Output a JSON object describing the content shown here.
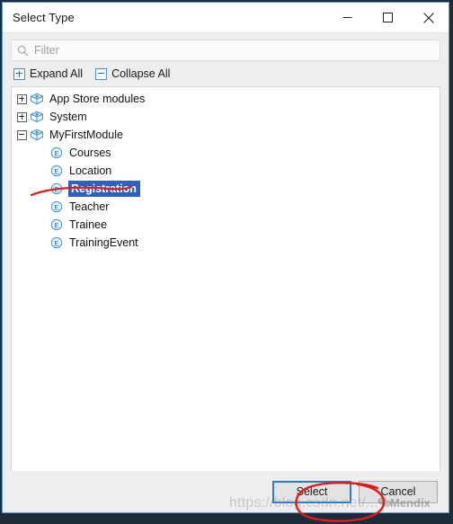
{
  "window": {
    "title": "Select Type",
    "controls": [
      {
        "name": "minimize",
        "glyph": "minimize-icon"
      },
      {
        "name": "maximize",
        "glyph": "maximize-icon"
      },
      {
        "name": "close",
        "glyph": "close-icon"
      }
    ]
  },
  "search": {
    "placeholder": "Filter",
    "value": "",
    "icon": "search-icon"
  },
  "toolbar": {
    "expand_all": "Expand All",
    "collapse_all": "Collapse All",
    "expand_icon": "plus-box-icon",
    "collapse_icon": "minus-box-icon"
  },
  "tree": {
    "nodes": [
      {
        "label": "App Store modules",
        "icon": "module-package-icon",
        "twisty": "plus",
        "depth": 0,
        "selected": false
      },
      {
        "label": "System",
        "icon": "module-package-icon",
        "twisty": "plus",
        "depth": 0,
        "selected": false
      },
      {
        "label": "MyFirstModule",
        "icon": "module-package-icon",
        "twisty": "minus",
        "depth": 0,
        "selected": false
      },
      {
        "label": "Courses",
        "icon": "entity-icon",
        "twisty": "none",
        "depth": 1,
        "selected": false
      },
      {
        "label": "Location",
        "icon": "entity-icon",
        "twisty": "none",
        "depth": 1,
        "selected": false
      },
      {
        "label": "Registration",
        "icon": "entity-icon",
        "twisty": "none",
        "depth": 1,
        "selected": true
      },
      {
        "label": "Teacher",
        "icon": "entity-icon",
        "twisty": "none",
        "depth": 1,
        "selected": false
      },
      {
        "label": "Trainee",
        "icon": "entity-icon",
        "twisty": "none",
        "depth": 1,
        "selected": false
      },
      {
        "label": "TrainingEvent",
        "icon": "entity-icon",
        "twisty": "none",
        "depth": 1,
        "selected": false
      }
    ]
  },
  "footer": {
    "select_label": "Select",
    "cancel_label": "Cancel"
  },
  "watermarks": {
    "url": "https://blog.csdn.net/...",
    "brand": "Mendix",
    "brand_icon": "wechat-icon"
  },
  "colors": {
    "selection": "#2a61c2",
    "accent": "#5a9bd5",
    "annotation": "#e01b1b",
    "window_border": "#5a9bd5",
    "panel_bg": "#eeeeee",
    "tree_bg": "#ffffff"
  }
}
